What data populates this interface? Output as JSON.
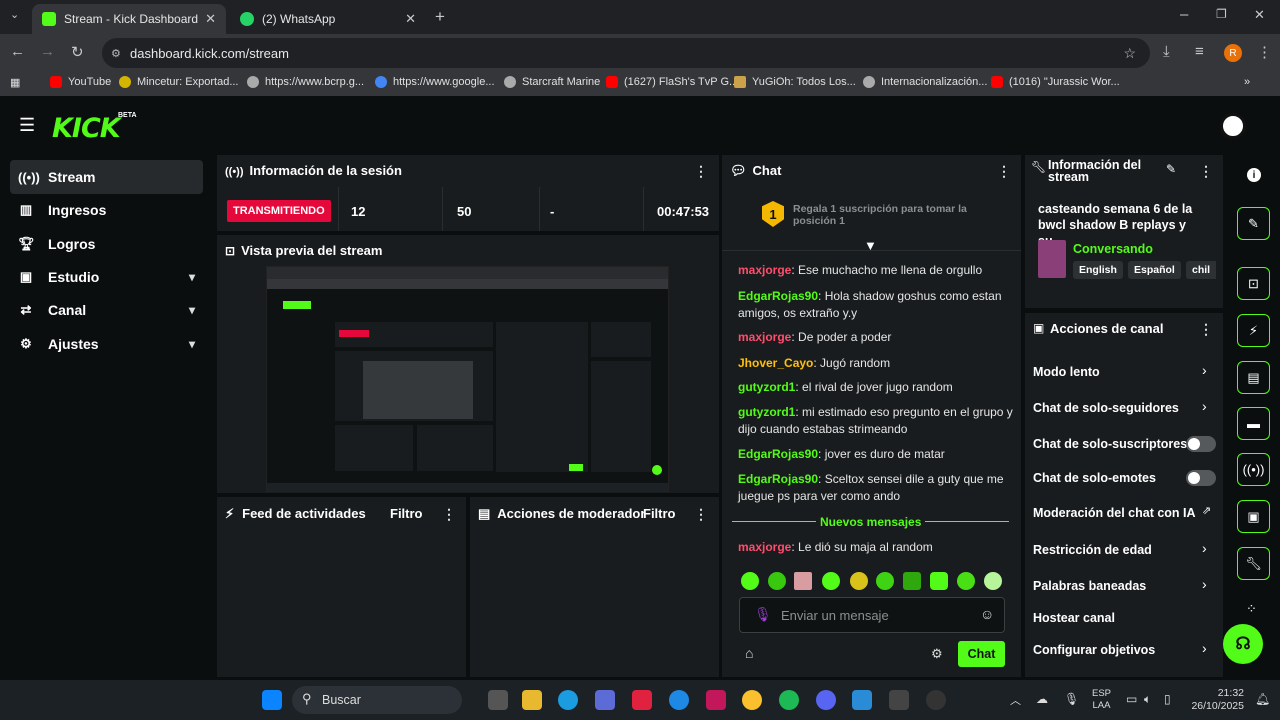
{
  "browser": {
    "tabs": [
      {
        "title": "Stream - Kick Dashboard",
        "active": true
      },
      {
        "title": "(2) WhatsApp",
        "active": false
      }
    ],
    "url": "dashboard.kick.com/stream",
    "profile_initial": "R",
    "bookmarks": [
      "YouTube",
      "Mincetur: Exportad...",
      "https://www.bcrp.g...",
      "https://www.google...",
      "Starcraft Marine",
      "(1627) FlaSh's TvP G...",
      "YuGiOh: Todos Los...",
      "Internacionalización...",
      "(1016) \"Jurassic Wor..."
    ]
  },
  "kick": {
    "logo": "KICK",
    "beta": "BETA",
    "nav": [
      {
        "label": "Stream",
        "icon": "broadcast-icon",
        "active": true
      },
      {
        "label": "Ingresos",
        "icon": "chart-icon"
      },
      {
        "label": "Logros",
        "icon": "trophy-icon"
      },
      {
        "label": "Estudio",
        "icon": "studio-icon",
        "expandable": true
      },
      {
        "label": "Canal",
        "icon": "channel-icon",
        "expandable": true
      },
      {
        "label": "Ajustes",
        "icon": "gear-icon",
        "expandable": true
      }
    ]
  },
  "session": {
    "title": "Información de la sesión",
    "status": "TRANSMITIENDO",
    "viewers": "12",
    "followers": "50",
    "subs": "-",
    "duration": "00:47:53"
  },
  "preview": {
    "title": "Vista previa del stream"
  },
  "feed": {
    "title": "Feed de actividades",
    "filter": "Filtro"
  },
  "mod_actions": {
    "title": "Acciones de moderador",
    "filter": "Filtro"
  },
  "chat": {
    "title": "Chat",
    "gift_rank": "1",
    "gift_text": "Regala 1 suscripción para tomar la posición 1",
    "messages": [
      {
        "user": "maxjorge",
        "color": "#ff4d6d",
        "text": "Ese muchacho me llena de orgullo"
      },
      {
        "user": "EdgarRojas90",
        "color": "#53fc18",
        "text": "Hola shadow goshus como estan amigos, os extraño y.y"
      },
      {
        "user": "maxjorge",
        "color": "#ff4d6d",
        "text": "De poder a poder"
      },
      {
        "user": "Jhover_Cayo",
        "color": "#ffc107",
        "text": "Jugó random"
      },
      {
        "user": "gutyzord1",
        "color": "#53fc18",
        "text": "el rival de jover jugo random"
      },
      {
        "user": "gutyzord1",
        "color": "#53fc18",
        "text": "mi estimado eso pregunto en el grupo y dijo cuando estabas strimeando"
      },
      {
        "user": "EdgarRojas90",
        "color": "#53fc18",
        "text": "jover es duro de matar"
      },
      {
        "user": "EdgarRojas90",
        "color": "#53fc18",
        "text": "Sceltox sensei dile a guty que me juegue ps para ver como ando"
      }
    ],
    "new_messages": "Nuevos mensajes",
    "new_message": {
      "user": "maxjorge",
      "color": "#ff4d6d",
      "text": "Le dió su maja al random"
    },
    "input_placeholder": "Enviar un mensaje",
    "send_label": "Chat"
  },
  "stream_info": {
    "title": "Información del stream",
    "stream_title": "casteando semana 6 de la bwcl shadow B replays y su...",
    "category": "Conversando",
    "tags": [
      "English",
      "Español",
      "chil"
    ]
  },
  "channel_actions": {
    "title": "Acciones de canal",
    "items": [
      {
        "label": "Modo lento",
        "kind": "chevron"
      },
      {
        "label": "Chat de solo-seguidores",
        "kind": "chevron"
      },
      {
        "label": "Chat de solo-suscriptores",
        "kind": "toggle"
      },
      {
        "label": "Chat de solo-emotes",
        "kind": "toggle"
      },
      {
        "label": "Moderación del chat con IA",
        "kind": "external"
      },
      {
        "label": "Restricción de edad",
        "kind": "chevron"
      },
      {
        "label": "Palabras baneadas",
        "kind": "chevron"
      },
      {
        "label": "Hostear canal",
        "kind": "none"
      },
      {
        "label": "Configurar objetivos",
        "kind": "chevron"
      }
    ]
  },
  "taskbar": {
    "search": "Buscar",
    "lang": "ESP",
    "lang2": "LAA",
    "time": "21:32",
    "date": "26/10/2025"
  },
  "colors": {
    "accent": "#53fc18",
    "live": "#e5083b",
    "panel": "#191c1e",
    "bg": "#0b0e0f"
  }
}
